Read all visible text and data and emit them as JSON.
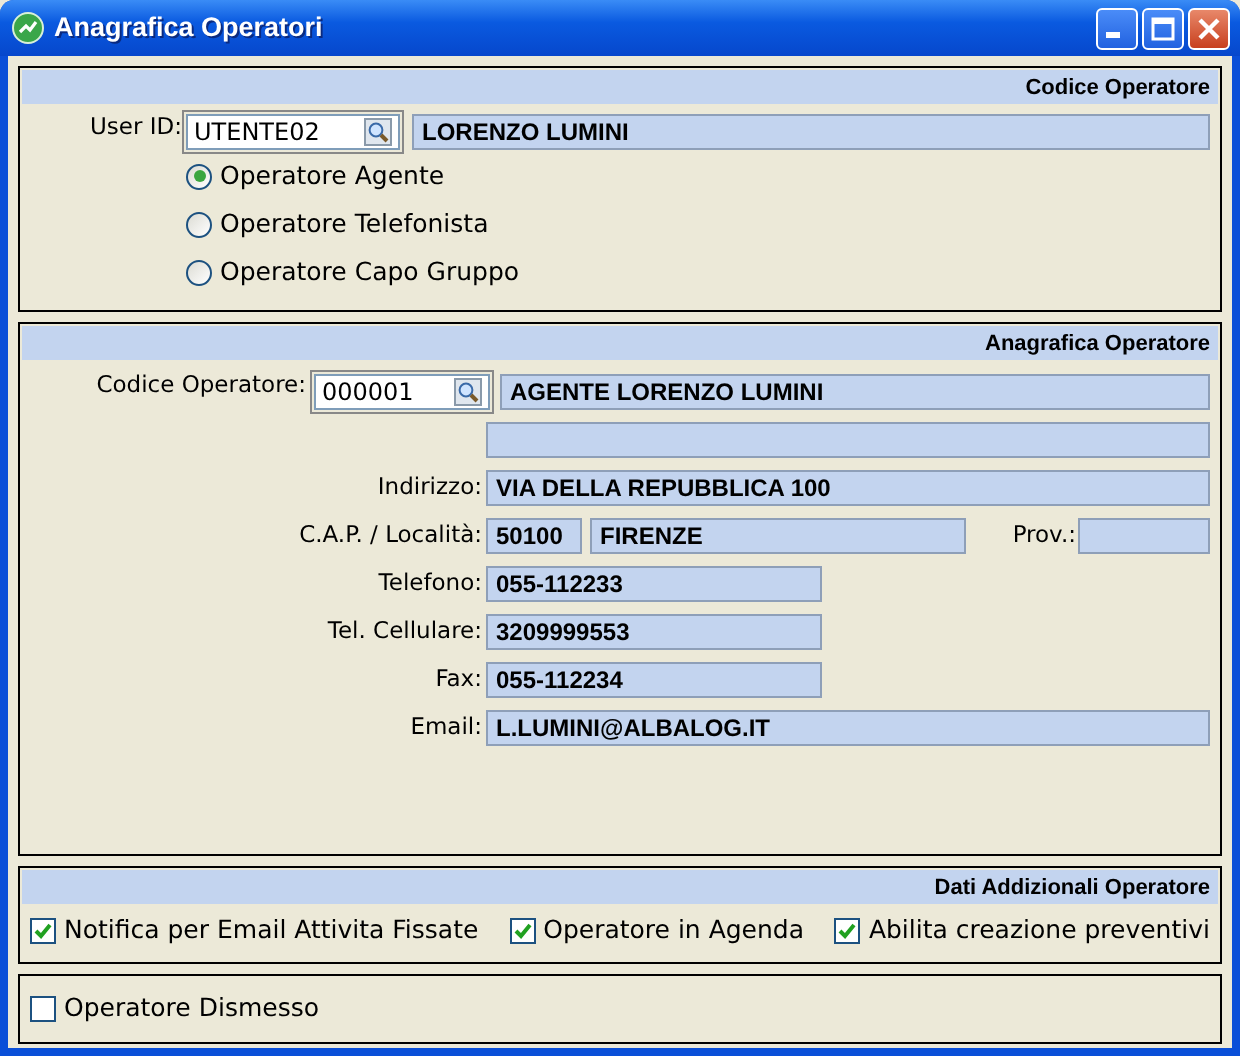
{
  "window": {
    "title": "Anagrafica Operatori"
  },
  "codice_operatore": {
    "title": "Codice Operatore",
    "user_id_label": "User ID:",
    "user_id": "UTENTE02",
    "name": "LORENZO LUMINI",
    "roles": [
      {
        "label": "Operatore Agente",
        "selected": true
      },
      {
        "label": "Operatore Telefonista",
        "selected": false
      },
      {
        "label": "Operatore Capo Gruppo",
        "selected": false
      }
    ]
  },
  "anagrafica": {
    "title": "Anagrafica Operatore",
    "rows": [
      {
        "kind": "lookup",
        "label": "Codice Operatore:",
        "code": "000001",
        "value": "AGENTE LORENZO LUMINI"
      },
      {
        "kind": "blank"
      },
      {
        "kind": "full",
        "label": "Indirizzo:",
        "value": "VIA DELLA REPUBBLICA 100"
      },
      {
        "kind": "cap",
        "label": "C.A.P. / Località:",
        "cap": "50100",
        "city": "FIRENZE",
        "prov_label": "Prov.:"
      },
      {
        "kind": "short",
        "label": "Telefono:",
        "value": "055-112233"
      },
      {
        "kind": "short",
        "label": "Tel. Cellulare:",
        "value": "3209999553"
      },
      {
        "kind": "short",
        "label": "Fax:",
        "value": "055-112234"
      },
      {
        "kind": "full",
        "label": "Email:",
        "value": "L.LUMINI@ALBALOG.IT"
      }
    ]
  },
  "dati_addizionali": {
    "title": "Dati Addizionali Operatore",
    "options": [
      {
        "label": "Notifica per Email Attivita Fissate",
        "checked": true
      },
      {
        "label": "Operatore in Agenda",
        "checked": true
      },
      {
        "label": "Abilita creazione preventivi",
        "checked": true
      }
    ]
  },
  "dismesso": {
    "label": "Operatore Dismesso",
    "checked": false
  }
}
